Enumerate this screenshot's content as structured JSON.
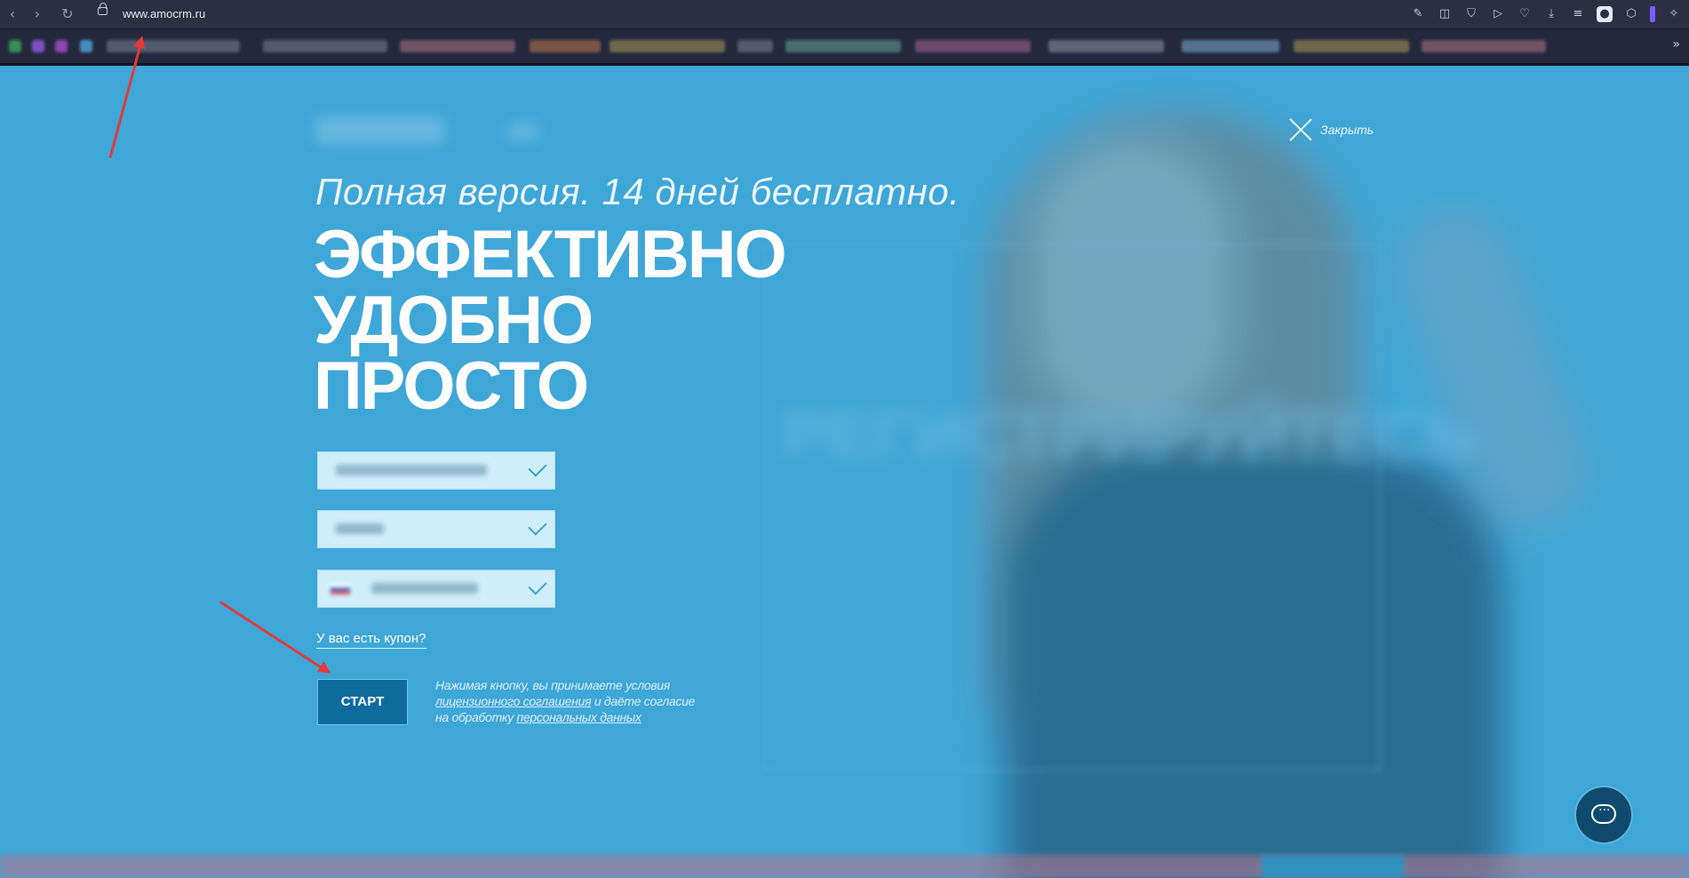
{
  "browser": {
    "url": "www.amocrm.ru",
    "nav": {
      "back": "‹",
      "forward": "›",
      "reload": "↻"
    },
    "toolbar_icons": [
      "edit-icon",
      "camera-icon",
      "shield-icon",
      "send-icon",
      "heart-icon",
      "download-icon",
      "menu-icon",
      "profile-icon",
      "extensions-icon"
    ],
    "bookmarks_more": "»"
  },
  "page": {
    "close_label": "Закрыть",
    "subtitle": "Полная версия. 14 дней бесплатно.",
    "headline": [
      "ЭФФЕКТИВНО",
      "УДОБНО",
      "ПРОСТО"
    ],
    "coupon_link": "У вас есть купон?",
    "start_button": "СТАРТ",
    "legal": {
      "part1": "Нажимая кнопку, вы принимаете условия",
      "license_link": "лицензионного соглашения",
      "part2": " и даёте согласие",
      "part3": "на обработку ",
      "personal_link": "персональных данных"
    }
  },
  "colors": {
    "page_bg": "#3fa6d8",
    "chrome_bg": "#252a3e",
    "button_bg": "#0f6b9e",
    "field_bg": "#cfeefc",
    "annotation_arrow": "#e03a3a"
  }
}
